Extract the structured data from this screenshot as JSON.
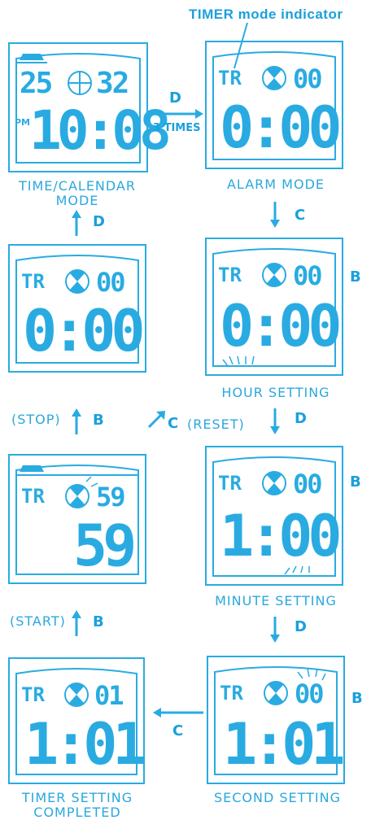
{
  "header": {
    "indicator_label": "TIMER mode indicator"
  },
  "screens": [
    {
      "id": "time-calendar",
      "top_left": "25",
      "top_right": "32",
      "ampm": "PM",
      "main": "10:08",
      "caption": "TIME/CALENDAR MODE"
    },
    {
      "id": "alarm",
      "top_left": "TR",
      "top_right": "00",
      "main": "0:00",
      "caption": "ALARM MODE"
    },
    {
      "id": "timer-stopped",
      "top_left": "TR",
      "top_right": "00",
      "main": "0:00",
      "caption": ""
    },
    {
      "id": "hour-setting",
      "top_left": "TR",
      "top_right": "00",
      "main": "0:00",
      "caption": "HOUR SETTING"
    },
    {
      "id": "timer-running",
      "top_left": "TR",
      "top_right": "59",
      "main": "59",
      "caption": ""
    },
    {
      "id": "minute-setting",
      "top_left": "TR",
      "top_right": "00",
      "main": "1:00",
      "caption": "MINUTE SETTING"
    },
    {
      "id": "timer-completed",
      "top_left": "TR",
      "top_right": "01",
      "main": "1:01",
      "caption_line1": "TIMER SETTING",
      "caption_line2": "COMPLETED"
    },
    {
      "id": "second-setting",
      "top_left": "TR",
      "top_right": "00",
      "main": "1:01",
      "caption": "SECOND SETTING"
    }
  ],
  "transitions": {
    "time_to_alarm": {
      "key": "D",
      "note": "3 TIMES"
    },
    "alarm_to_hour": {
      "key": "C"
    },
    "hour_to_minute": {
      "key": "D"
    },
    "minute_to_second": {
      "key": "D"
    },
    "second_to_completed": {
      "key": "C"
    },
    "completed_to_running": {
      "key": "B",
      "note": "(START)"
    },
    "running_to_stopped": {
      "key": "B",
      "note": "(STOP)"
    },
    "running_reset": {
      "key": "C",
      "note": "(RESET)"
    },
    "stopped_to_time": {
      "key": "D"
    },
    "hour_side": {
      "key": "B"
    },
    "minute_side": {
      "key": "B"
    },
    "second_side": {
      "key": "B"
    }
  },
  "colors": {
    "accent": "#29abe2",
    "bold_key": "#1aa0dc",
    "background": "#ffffff"
  }
}
